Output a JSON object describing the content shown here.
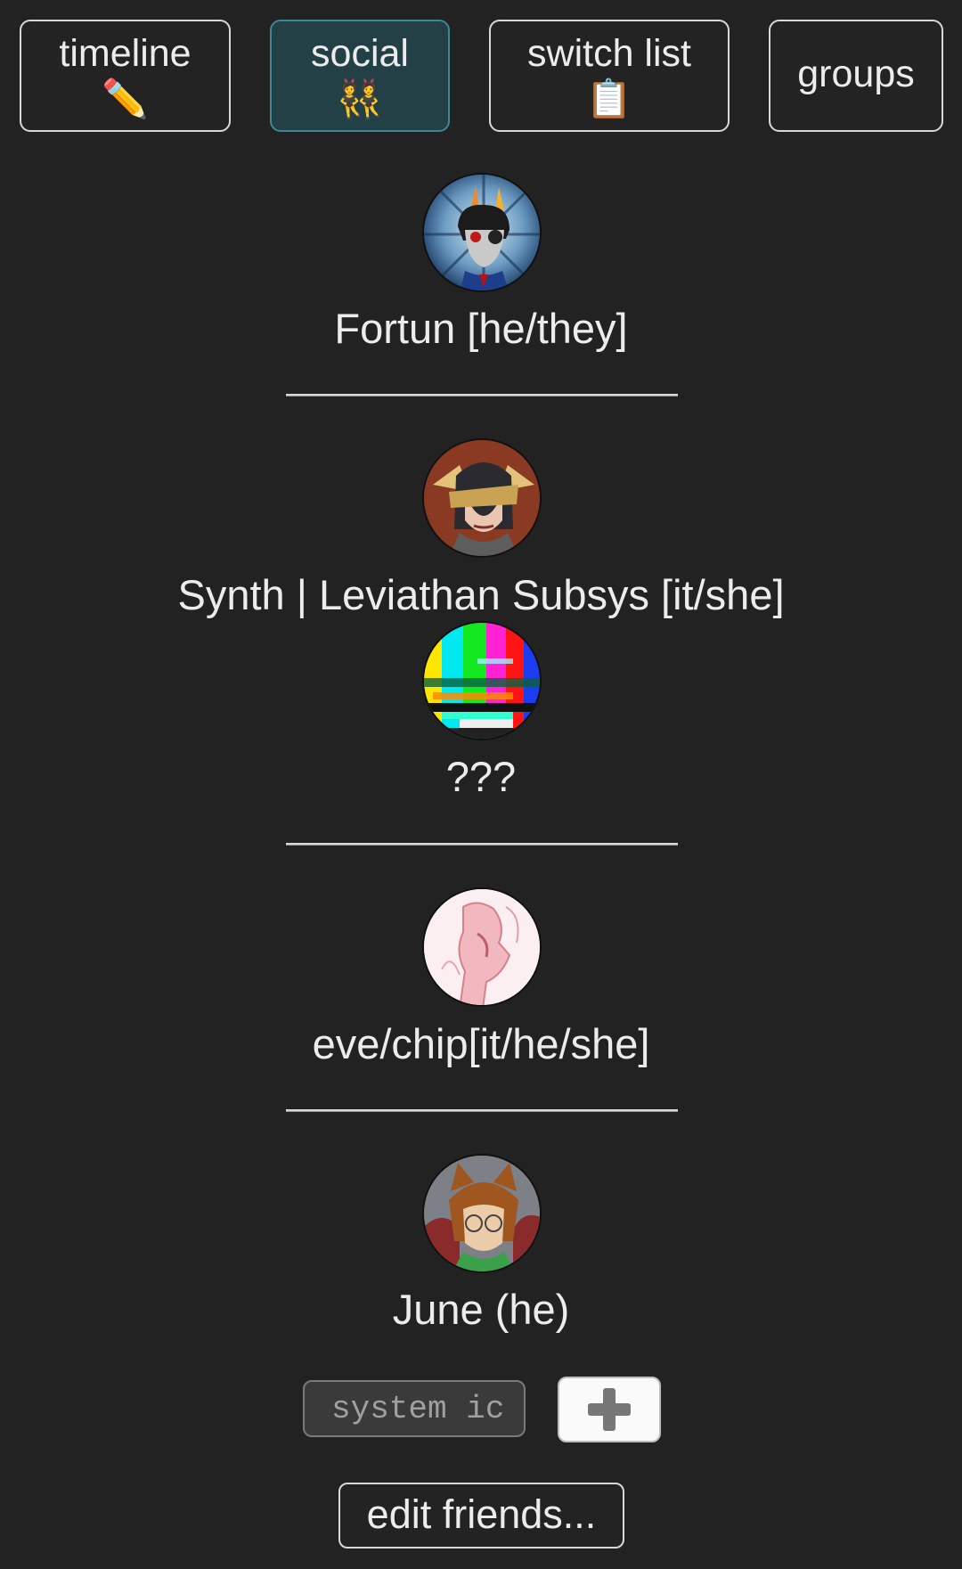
{
  "tabs": [
    {
      "label": "timeline",
      "icon": "✏️",
      "icon_name": "pencil-icon",
      "active": false
    },
    {
      "label": "social",
      "icon": "👯",
      "icon_name": "dancers-icon",
      "active": true
    },
    {
      "label": "switch list",
      "icon": "📋",
      "icon_name": "clipboard-icon",
      "active": false
    },
    {
      "label": "groups",
      "active": false
    }
  ],
  "friends": [
    {
      "name": "Fortun [he/they]",
      "avatar_icon": "troll-avatar"
    },
    {
      "name": "Synth | Leviathan Subsys [it/she]",
      "avatar_icon": "blindfolded-avatar"
    },
    {
      "name": "???",
      "avatar_icon": "glitch-avatar"
    },
    {
      "name": "eve/chip[it/he/she]",
      "avatar_icon": "sketch-avatar"
    },
    {
      "name": "June (he)",
      "avatar_icon": "catgirl-avatar"
    }
  ],
  "add_form": {
    "input_placeholder": "system ic",
    "add_button_icon": "plus-icon"
  },
  "edit_button_label": "edit friends...",
  "colors": {
    "background": "#222222",
    "active_tab": "#234046",
    "active_tab_border": "#3f8793"
  }
}
